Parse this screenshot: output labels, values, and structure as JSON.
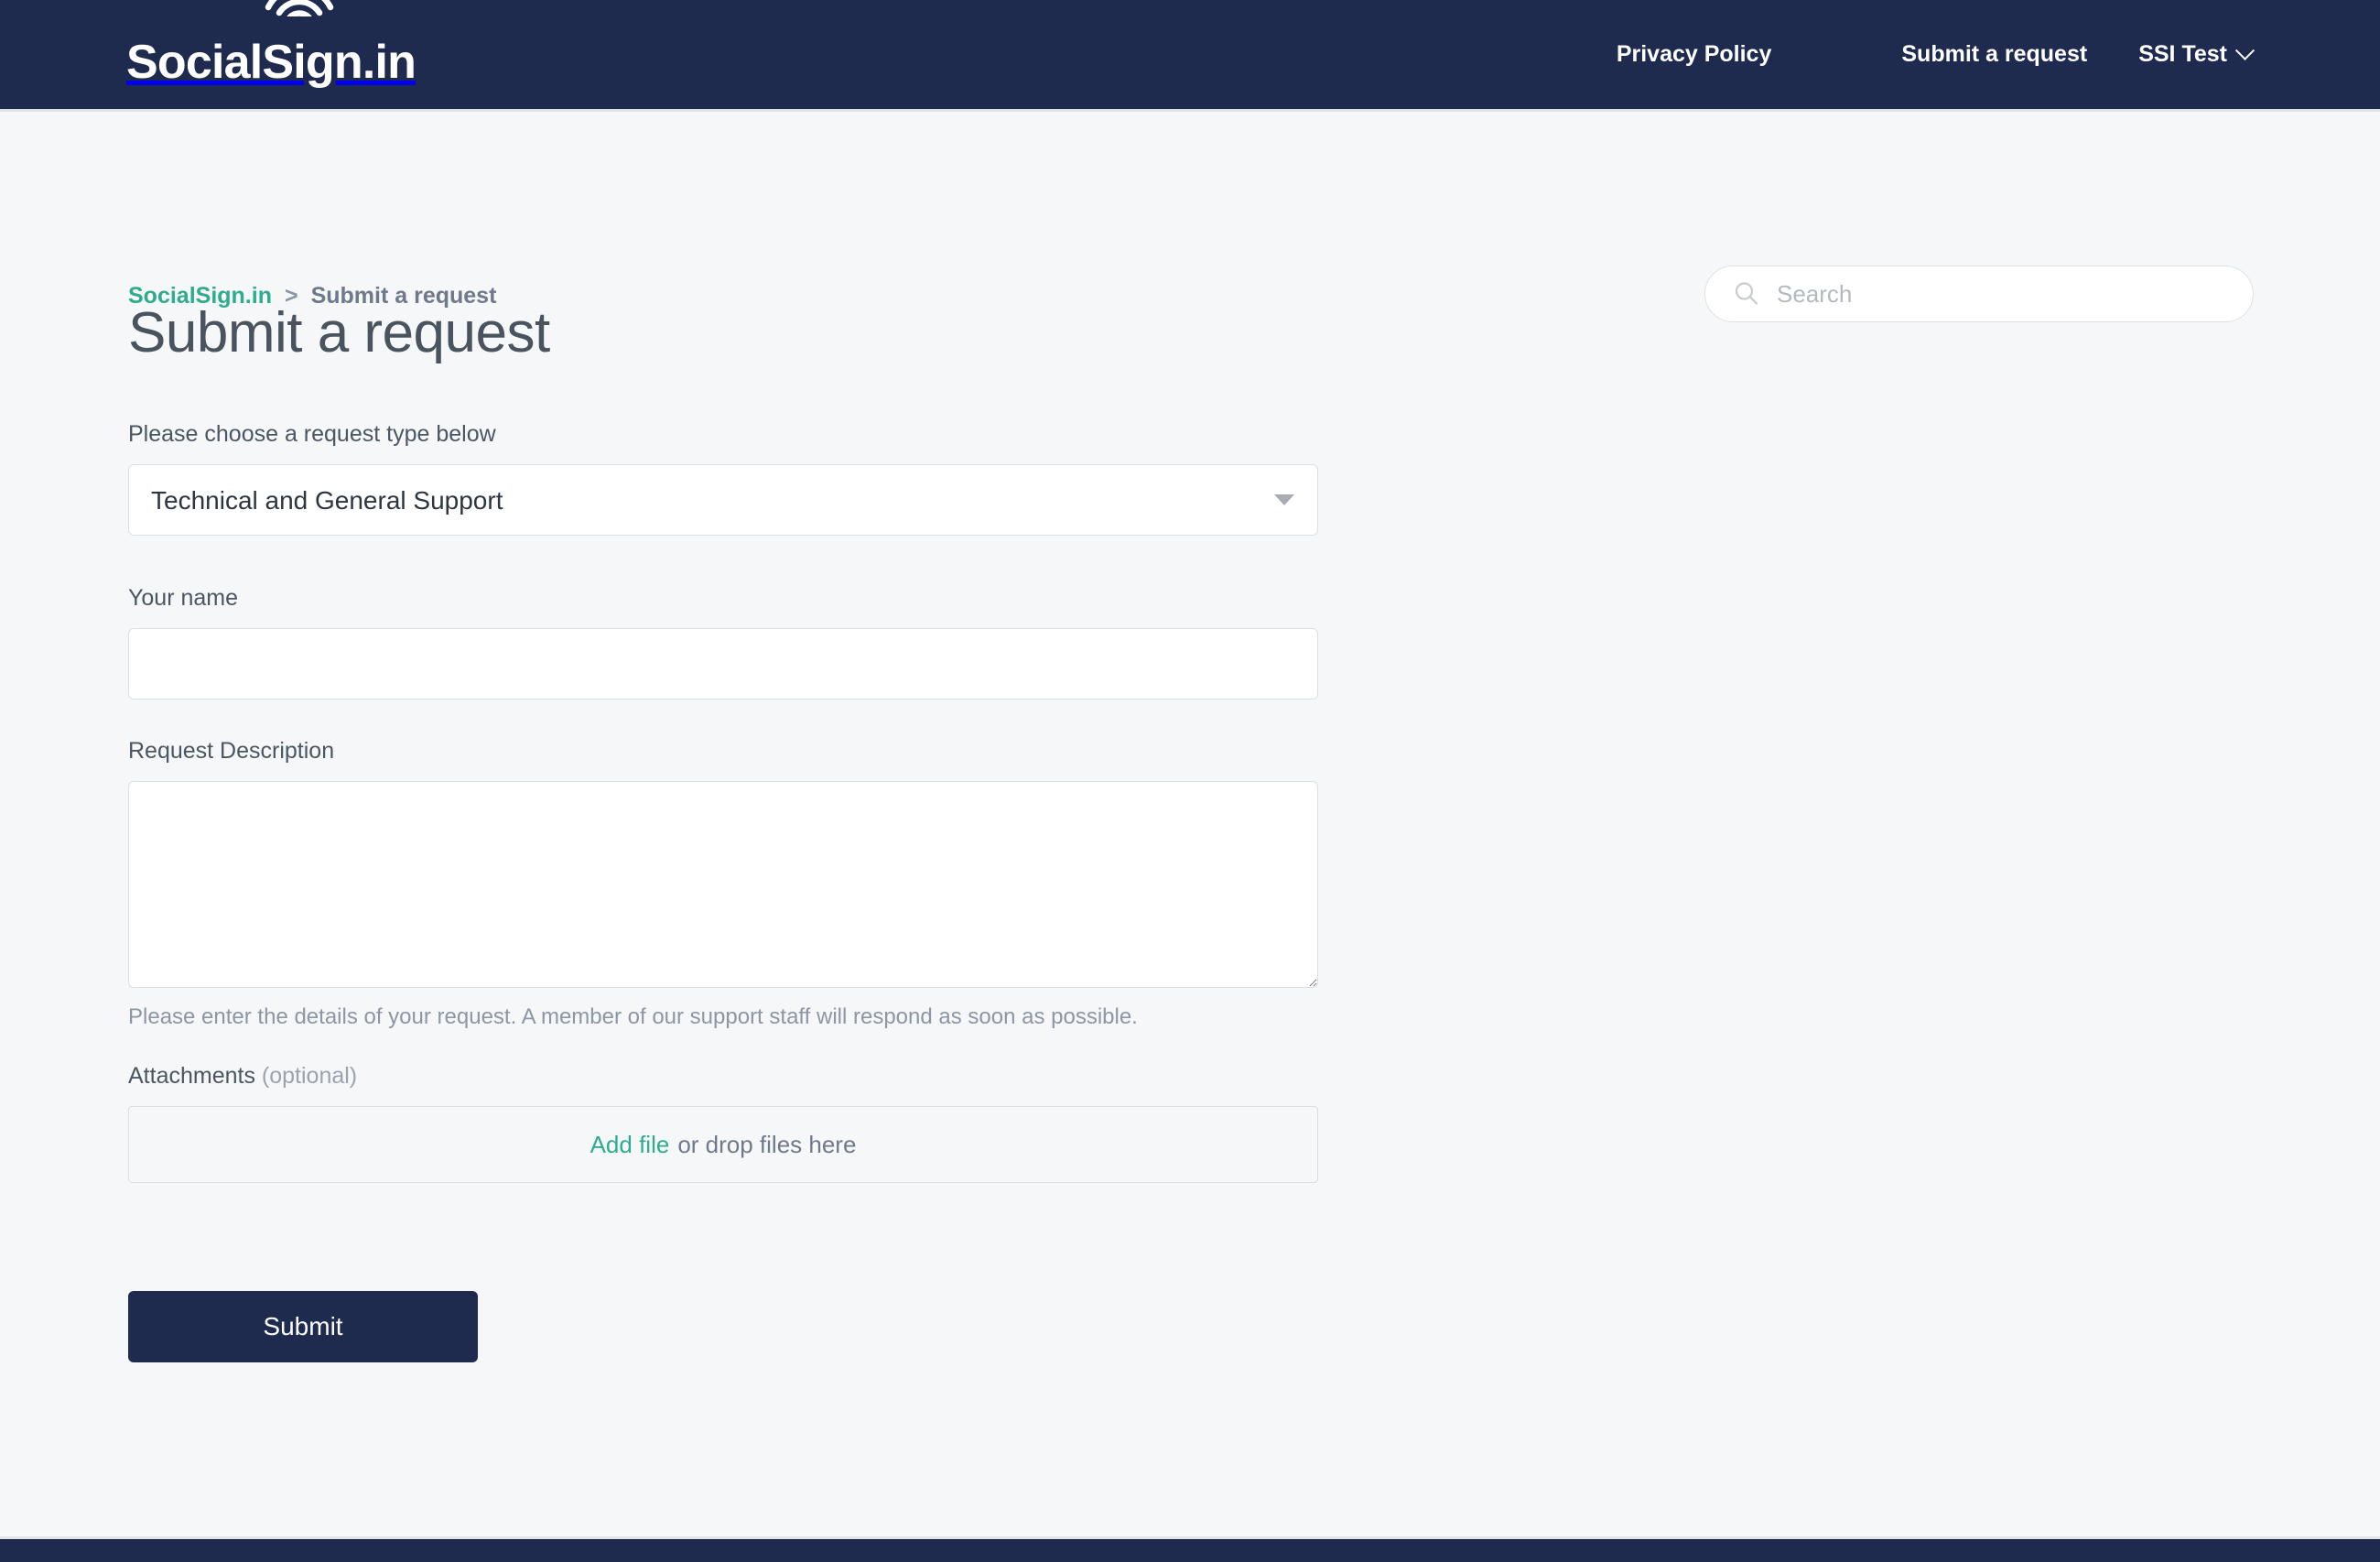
{
  "header": {
    "logo_text": "SocialSign.in",
    "logo_icon": "wifi-arc-icon",
    "nav": {
      "privacy_policy": "Privacy Policy",
      "submit_request": "Submit a request",
      "user_name": "SSI Test",
      "user_chevron_icon": "chevron-down-icon"
    }
  },
  "breadcrumb": {
    "home_label": "SocialSign.in",
    "separator": ">",
    "current_label": "Submit a request"
  },
  "search": {
    "icon": "search-icon",
    "placeholder": "Search",
    "value": ""
  },
  "main": {
    "page_title": "Submit a request",
    "request_type": {
      "label": "Please choose a request type below",
      "selected": "Technical and General Support",
      "caret_icon": "triangle-down-icon"
    },
    "your_name": {
      "label": "Your name",
      "value": "",
      "placeholder": ""
    },
    "request_description": {
      "label": "Request Description",
      "value": "",
      "placeholder": "",
      "hint": "Please enter the details of your request. A member of our support staff will respond as soon as possible."
    },
    "attachments": {
      "label": "Attachments",
      "optional_label": "(optional)",
      "add_file_link": "Add file",
      "drop_text": "or drop files here"
    },
    "submit_label": "Submit"
  },
  "colors": {
    "header_navy": "#1e2a4e",
    "accent_teal": "#2fab8e",
    "page_background": "#f6f7f9",
    "text_dark": "#49545f",
    "text_muted": "#8d96a4",
    "border_gray": "#dcdfe3"
  }
}
